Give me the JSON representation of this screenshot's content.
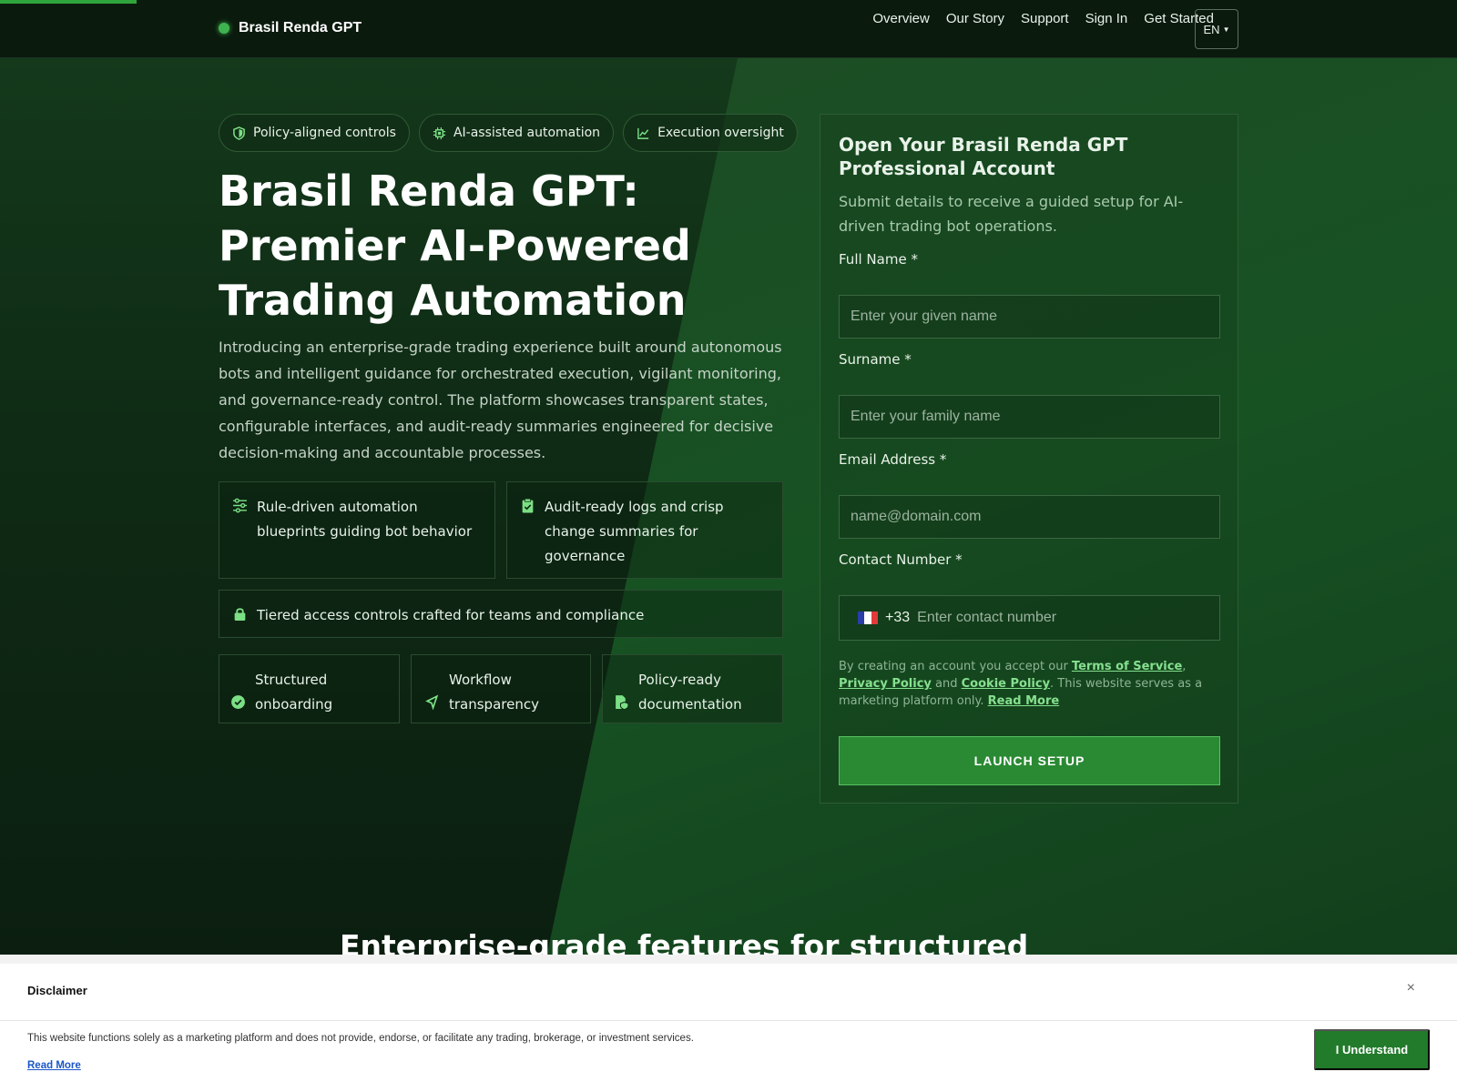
{
  "header": {
    "brand": "Brasil Renda GPT",
    "nav": [
      "Overview",
      "Our Story",
      "Support",
      "Sign In",
      "Get Started"
    ],
    "language": "EN"
  },
  "hero": {
    "pills": [
      "Policy-aligned controls",
      "AI-assisted automation",
      "Execution oversight"
    ],
    "title": "Brasil Renda GPT: Premier AI-Powered Trading Automation",
    "intro": "Introducing an enterprise-grade trading experience built around autonomous bots and intelligent guidance for orchestrated execution, vigilant monitoring, and governance-ready control. The platform showcases transparent states, configurable interfaces, and audit-ready summaries engineered for decisive decision-making and accountable processes.",
    "cards": {
      "automation": "Rule-driven automation blueprints guiding bot behavior",
      "audit": "Audit-ready logs and crisp change summaries for governance",
      "access": "Tiered access controls crafted for teams and compliance",
      "onboarding": "Structured onboarding",
      "workflow": "Workflow transparency",
      "policy": "Policy-ready documentation"
    }
  },
  "form": {
    "title": "Open Your Brasil Renda GPT Professional Account",
    "subtitle": "Submit details to receive a guided setup for AI-driven trading bot operations.",
    "full_name_label": "Full Name *",
    "full_name_placeholder": "Enter your given name",
    "surname_label": "Surname *",
    "surname_placeholder": "Enter your family name",
    "email_label": "Email Address *",
    "email_placeholder": "name@domain.com",
    "phone_label": "Contact Number *",
    "phone_code": "+33",
    "phone_placeholder": "Enter contact number",
    "terms_prefix": "By creating an account you accept our ",
    "terms_link": "Terms of Service",
    "terms_comma": ", ",
    "privacy_link": "Privacy Policy",
    "terms_and": " and ",
    "cookie_link": "Cookie Policy",
    "terms_suffix": ". This website serves as a marketing platform only. ",
    "read_more": "Read More",
    "submit": "LAUNCH SETUP"
  },
  "features_heading": "Enterprise-grade features for structured",
  "disclaimer": {
    "title": "Disclaimer",
    "close": "×",
    "text": "This website functions solely as a marketing platform and does not provide, endorse, or facilitate any trading, brokerage, or investment services.",
    "read_more": "Read More",
    "button": "I Understand"
  },
  "colors": {
    "accent": "#2fa33c",
    "background": "#0b1e10",
    "link": "#86e08f"
  }
}
